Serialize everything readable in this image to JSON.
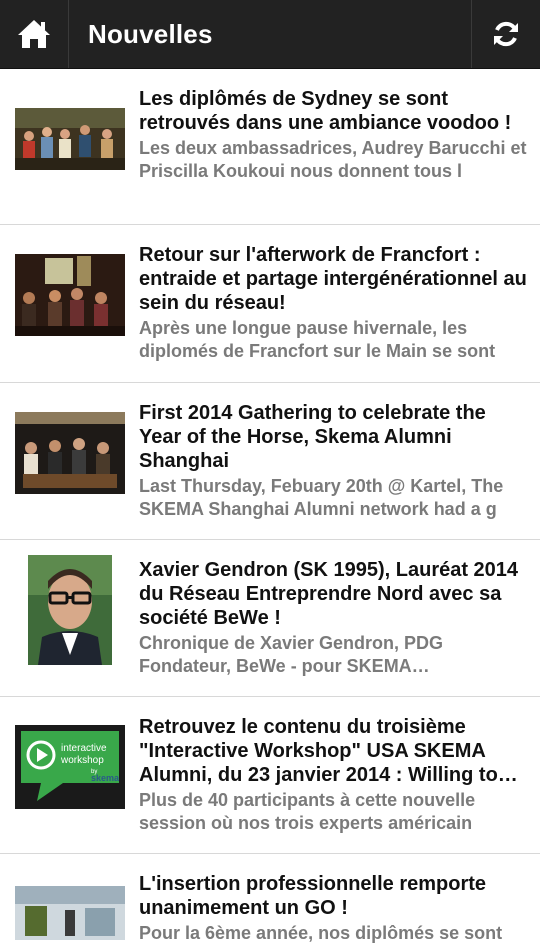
{
  "header": {
    "title": "Nouvelles",
    "home_icon": "home-icon",
    "refresh_icon": "refresh-icon"
  },
  "news": [
    {
      "title_lines": [
        "Les diplômés de Sydney se sont",
        "retrouvés dans une ambiance voodoo !"
      ],
      "desc_lines": [
        "Les deux ambassadrices, Audrey Barucchi et",
        "Priscilla Koukoui nous donnent tous l"
      ]
    },
    {
      "title_lines": [
        "Retour sur l'afterwork de Francfort :",
        "entraide et partage intergénérationnel au",
        "sein du réseau!"
      ],
      "desc_lines": [
        "Après une longue pause hivernale, les",
        "diplomés de Francfort sur le Main se sont"
      ]
    },
    {
      "title_lines": [
        "First 2014 Gathering  to celebrate the",
        "Year of the Horse, Skema Alumni",
        "Shanghai"
      ],
      "desc_lines": [
        "Last Thursday, Febuary 20th @ Kartel, The",
        "SKEMA Shanghai Alumni network  had a g"
      ]
    },
    {
      "title_lines": [
        "Xavier Gendron (SK 1995), Lauréat 2014",
        "du Réseau Entreprendre Nord avec sa",
        "société BeWe !"
      ],
      "desc_lines": [
        "Chronique de Xavier Gendron, PDG",
        "Fondateur, BeWe - pour SKEMA…"
      ]
    },
    {
      "title_lines": [
        "Retrouvez le contenu du troisième",
        "\"Interactive Workshop\" USA SKEMA",
        "Alumni, du 23 janvier 2014 : Willing to…"
      ],
      "desc_lines": [
        "Plus de 40 participants à cette nouvelle",
        "session où nos trois experts américain"
      ],
      "thumb_text": [
        "interactive",
        "workshop",
        "by",
        "skema"
      ]
    },
    {
      "title_lines": [
        "L'insertion professionnelle remporte",
        "unanimement un GO !"
      ],
      "desc_lines": [
        "Pour la 6ème année, nos diplômés se sont"
      ]
    }
  ]
}
